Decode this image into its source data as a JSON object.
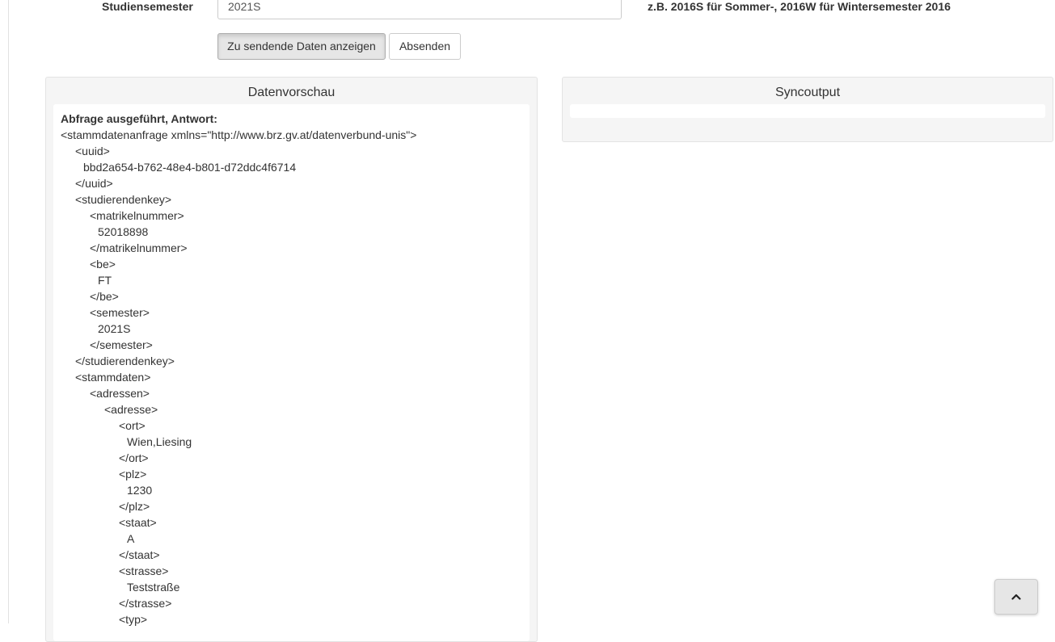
{
  "form": {
    "semester_label": "Studiensemester",
    "semester_value": "2021S",
    "semester_help": "z.B. 2016S für Sommer-, 2016W für Wintersemester 2016",
    "preview_button": "Zu sendende Daten anzeigen",
    "send_button": "Absenden"
  },
  "preview_panel": {
    "title": "Datenvorschau",
    "result_heading": "Abfrage ausgeführt, Antwort:",
    "lines": [
      {
        "text": "<stammdatenanfrage xmlns=\"http://www.brz.gv.at/datenverbund-unis\">",
        "indent": 0
      },
      {
        "text": "<uuid>",
        "indent": 1
      },
      {
        "text": "bbd2a654-b762-48e4-b801-d72ddc4f6714",
        "indent": 1.5
      },
      {
        "text": "</uuid>",
        "indent": 1
      },
      {
        "text": "<studierendenkey>",
        "indent": 1
      },
      {
        "text": "<matrikelnummer>",
        "indent": 2
      },
      {
        "text": "52018898",
        "indent": 2.5
      },
      {
        "text": "</matrikelnummer>",
        "indent": 2
      },
      {
        "text": "<be>",
        "indent": 2
      },
      {
        "text": "FT",
        "indent": 2.5
      },
      {
        "text": "</be>",
        "indent": 2
      },
      {
        "text": "<semester>",
        "indent": 2
      },
      {
        "text": "2021S",
        "indent": 2.5
      },
      {
        "text": "</semester>",
        "indent": 2
      },
      {
        "text": "</studierendenkey>",
        "indent": 1
      },
      {
        "text": "<stammdaten>",
        "indent": 1
      },
      {
        "text": "<adressen>",
        "indent": 2
      },
      {
        "text": "<adresse>",
        "indent": 3
      },
      {
        "text": "<ort>",
        "indent": 4
      },
      {
        "text": "Wien,Liesing",
        "indent": 4.5
      },
      {
        "text": "</ort>",
        "indent": 4
      },
      {
        "text": "<plz>",
        "indent": 4
      },
      {
        "text": "1230",
        "indent": 4.5
      },
      {
        "text": "</plz>",
        "indent": 4
      },
      {
        "text": "<staat>",
        "indent": 4
      },
      {
        "text": "A",
        "indent": 4.5
      },
      {
        "text": "</staat>",
        "indent": 4
      },
      {
        "text": "<strasse>",
        "indent": 4
      },
      {
        "text": "Teststraße",
        "indent": 4.5
      },
      {
        "text": "</strasse>",
        "indent": 4
      },
      {
        "text": "<typ>",
        "indent": 4
      }
    ]
  },
  "sync_panel": {
    "title": "Syncoutput"
  },
  "scroll_top": {
    "icon": "chevron-up-icon"
  }
}
